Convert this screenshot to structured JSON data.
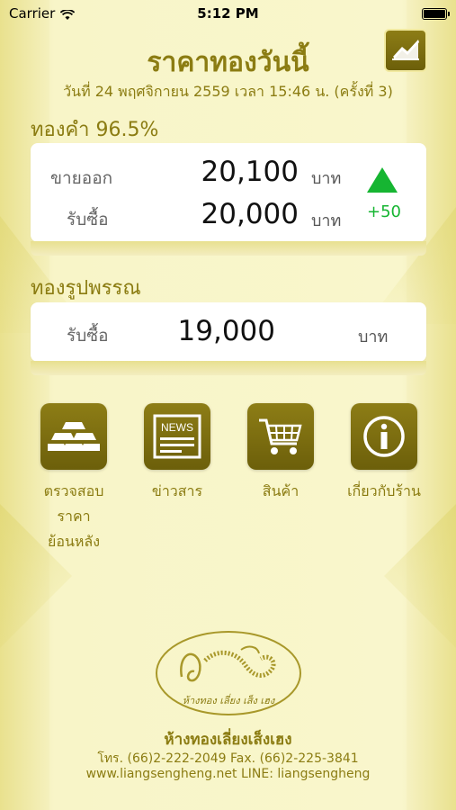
{
  "status_bar": {
    "carrier": "Carrier",
    "time": "5:12 PM"
  },
  "header": {
    "title": "ราคาทองวันนี้",
    "date_line": "วันที่ 24 พฤศจิกายน 2559 เวลา 15:46 น. (ครั้งที่ 3)",
    "chart_icon": "line-chart-icon"
  },
  "gold_bar": {
    "label": "ทองคำ 96.5%",
    "sell_label": "ขายออก",
    "sell_value": "20,100",
    "buy_label": "รับซื้อ",
    "buy_value": "20,000",
    "unit": "บาท",
    "change": "+50",
    "trend": "up",
    "trend_color": "#16b532"
  },
  "gold_ornament": {
    "label": "ทองรูปพรรณ",
    "buy_label": "รับซื้อ",
    "buy_value": "19,000",
    "unit": "บาท"
  },
  "menu": {
    "items": [
      {
        "label_line1": "ตรวจสอบราคา",
        "label_line2": "ย้อนหลัง",
        "icon": "gold-bars-icon"
      },
      {
        "label_line1": "ข่าวสาร",
        "label_line2": "",
        "icon": "news-icon",
        "icon_text": "NEWS"
      },
      {
        "label_line1": "สินค้า",
        "label_line2": "",
        "icon": "shopping-cart-icon"
      },
      {
        "label_line1": "เกี่ยวกับร้าน",
        "label_line2": "",
        "icon": "info-icon"
      }
    ]
  },
  "logo": {
    "text": "ห้างทอง เลี่ยง เส็ง เฮง"
  },
  "footer": {
    "name": "ห้างทองเลี่ยงเส็งเฮง",
    "phone": "โทร. (66)2-222-2049 Fax. (66)2-225-3841",
    "web": "www.liangsengheng.net LINE: liangsengheng"
  },
  "colors": {
    "accent": "#8b7c12",
    "icon_bg": "#7a6c10",
    "up": "#16b532"
  }
}
